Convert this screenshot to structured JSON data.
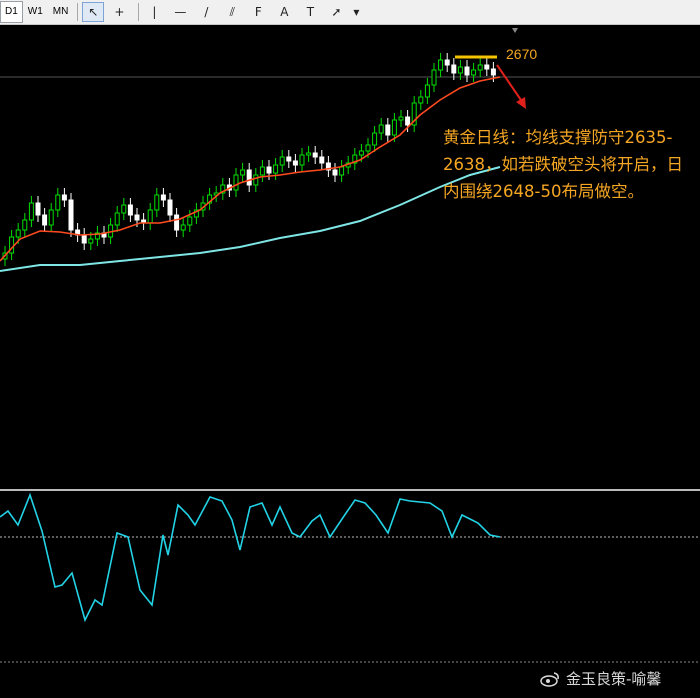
{
  "toolbar": {
    "timeframes": [
      "D1",
      "W1",
      "MN"
    ],
    "active_timeframe": "D1",
    "tools": [
      {
        "name": "cursor-tool-icon",
        "glyph": "↖"
      },
      {
        "name": "crosshair-tool-icon",
        "glyph": "+"
      },
      {
        "name": "vertical-line-tool-icon",
        "glyph": "|"
      },
      {
        "name": "horizontal-line-tool-icon",
        "glyph": "—"
      },
      {
        "name": "trendline-tool-icon",
        "glyph": "/"
      },
      {
        "name": "equidistant-channel-tool-icon",
        "glyph": "⫽"
      },
      {
        "name": "fibonacci-tool-icon",
        "glyph": "F"
      },
      {
        "name": "text-tool-icon",
        "glyph": "A"
      },
      {
        "name": "text-label-tool-icon",
        "glyph": "T"
      },
      {
        "name": "arrows-tool-icon",
        "glyph": "➚"
      },
      {
        "name": "dropdown-arrow-icon",
        "glyph": "▾"
      }
    ]
  },
  "chart": {
    "price_level_label": "2670",
    "annotation_text": "黄金日线：均线支撑防守2635-2638，如若跌破空头将开启，日内围绕2648-50布局做空。",
    "colors": {
      "bull": "#00e000",
      "bear": "#ffffff",
      "ma_fast": "#ff4b1f",
      "ma_slow": "#7fe6e6",
      "oscillator": "#22d3e6",
      "level_line": "#f5c400",
      "arrow": "#e0201a",
      "annotation": "#f5a623"
    }
  },
  "watermark": {
    "text": "金玉良策-喻馨"
  }
}
